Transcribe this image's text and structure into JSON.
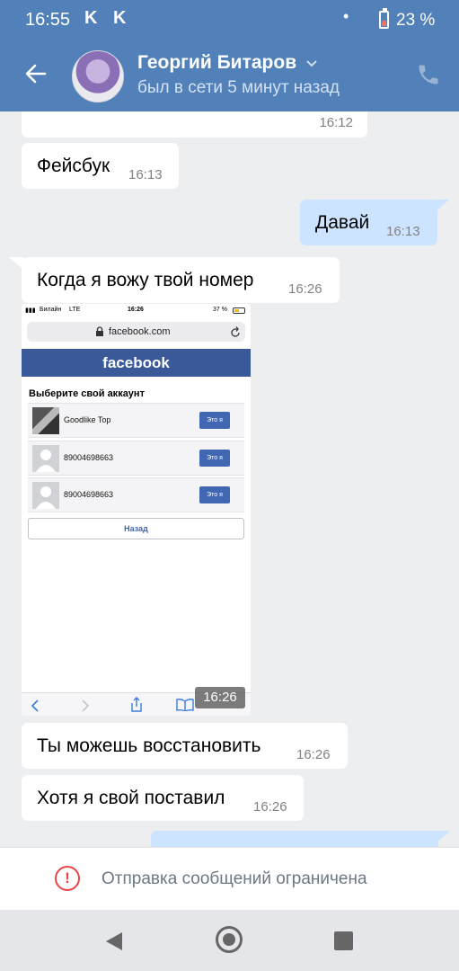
{
  "status_bar": {
    "time": "16:55",
    "notif_icons": [
      "K",
      "K"
    ],
    "battery_percent": "23 %",
    "battery_level": 0.23
  },
  "header": {
    "name": "Георгий Битаров",
    "status": "был в сети 5 минут назад"
  },
  "messages": [
    {
      "direction": "in",
      "text": "",
      "time": "16:12"
    },
    {
      "direction": "in",
      "text": "Фейсбук",
      "time": "16:13"
    },
    {
      "direction": "out",
      "text": "Давай",
      "time": "16:13"
    },
    {
      "direction": "in",
      "text": "Когда я вожу твой номер",
      "time": "16:26"
    },
    {
      "direction": "in",
      "type": "image",
      "time": "16:26"
    },
    {
      "direction": "in",
      "text": "Ты можешь восстановить",
      "time": "16:26"
    },
    {
      "direction": "in",
      "text": "Хотя я свой поставил",
      "time": "16:26"
    }
  ],
  "attachment": {
    "carrier": "Билайн",
    "network": "LTE",
    "time": "16:26",
    "battery": "37 %",
    "url": "facebook.com",
    "brand": "facebook",
    "heading": "Выберите свой аккаунт",
    "accounts": [
      {
        "name": "Goodlike Top",
        "button": "Это я"
      },
      {
        "name": "89004698663",
        "button": "Это я"
      },
      {
        "name": "89004698663",
        "button": "Это я"
      }
    ],
    "back_button": "Назад"
  },
  "restriction": {
    "text": "Отправка сообщений ограничена"
  },
  "colors": {
    "header": "#5181b8",
    "bubble_in": "#ffffff",
    "bubble_out": "#cce4ff",
    "chat_bg": "#edeef0",
    "warning": "#e64646",
    "facebook": "#3b5998"
  }
}
